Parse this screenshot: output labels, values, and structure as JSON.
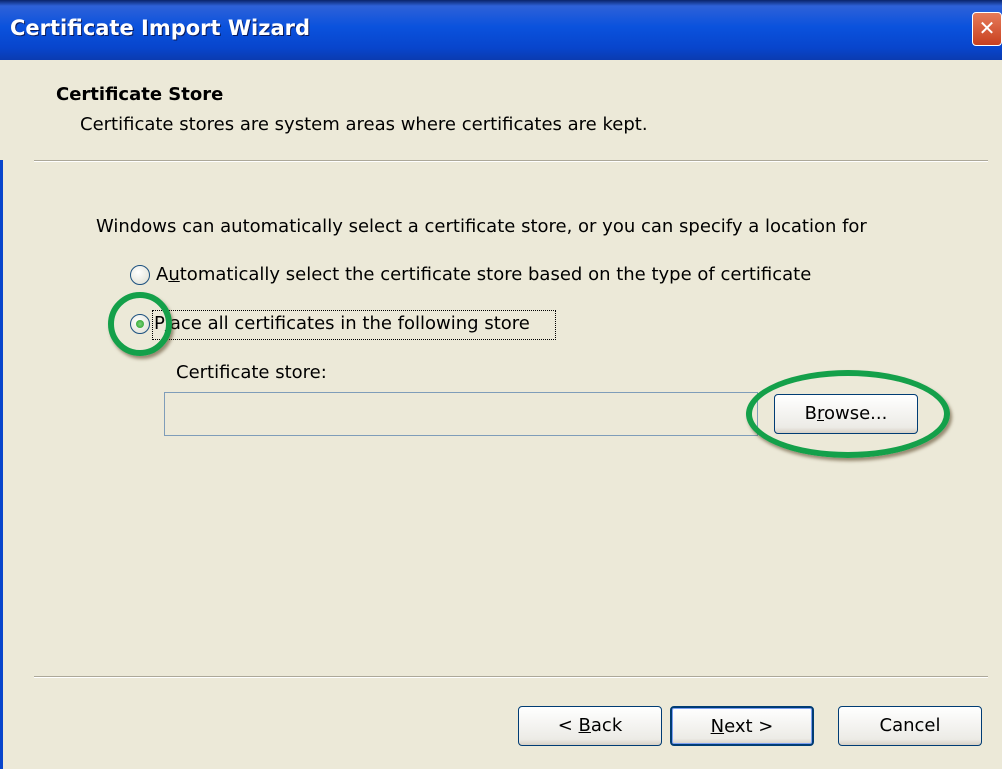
{
  "window": {
    "title": "Certificate Import Wizard"
  },
  "header": {
    "title": "Certificate Store",
    "subtitle": "Certificate stores are system areas where certificates are kept."
  },
  "body": {
    "intro": "Windows can automatically select a certificate store, or you can specify a location for",
    "option_auto": {
      "prefix": "A",
      "mnemonic": "u",
      "rest": "tomatically select the certificate store based on the type of certificate",
      "selected": false
    },
    "option_place": {
      "prefix": "P",
      "mnemonic": "l",
      "rest": "ace all certificates in the following store",
      "selected": true
    },
    "store_label": "Certificate store:",
    "store_value": "",
    "browse": {
      "prefix": "B",
      "mnemonic": "r",
      "rest": "owse..."
    }
  },
  "footer": {
    "back": {
      "prefix": "< ",
      "mnemonic": "B",
      "rest": "ack"
    },
    "next": {
      "prefix": "",
      "mnemonic": "N",
      "rest": "ext >"
    },
    "cancel": "Cancel"
  },
  "colors": {
    "highlight_ring": "#14a04a",
    "titlebar": "#0a52dd"
  }
}
